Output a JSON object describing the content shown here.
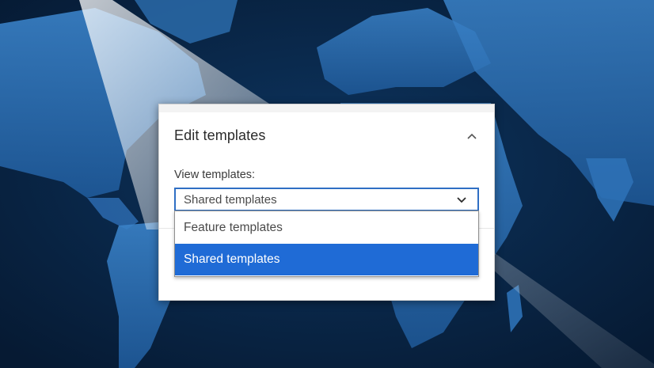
{
  "panel": {
    "title": "Edit templates",
    "collapse_icon": "chevron-up-icon"
  },
  "view_templates": {
    "label": "View templates:",
    "selected_value": "Shared templates",
    "chevron_icon": "chevron-down-icon",
    "options": [
      {
        "label": "Feature templates",
        "selected": false
      },
      {
        "label": "Shared templates",
        "selected": true
      }
    ]
  },
  "colors": {
    "accent": "#1f6bd6",
    "focus_border": "#2f6fc4",
    "map_ocean": "#0a2a4e",
    "map_land": "#2b6fb4"
  }
}
